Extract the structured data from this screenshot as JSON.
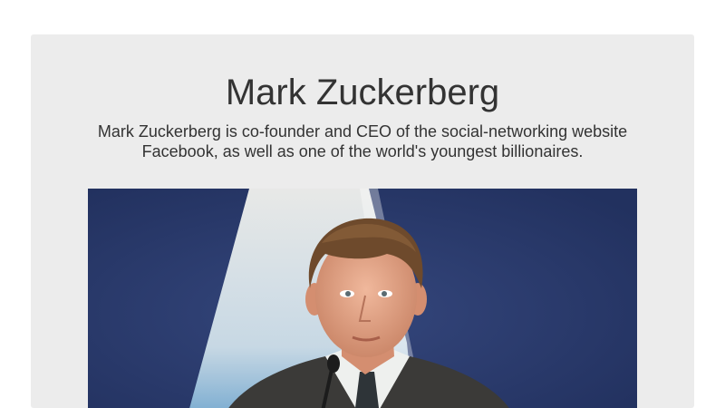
{
  "profile": {
    "name": "Mark Zuckerberg",
    "description": "Mark Zuckerberg is co-founder and CEO of the social-networking website Facebook, as well as one of the world's youngest billionaires."
  },
  "photo": {
    "subject": "portrait-photo",
    "colors": {
      "background": "#27386b",
      "spotlight": "#e9eef0",
      "suit": "#3a3a3a",
      "skin": "#e8a98e",
      "hair": "#6e4a2c"
    }
  }
}
